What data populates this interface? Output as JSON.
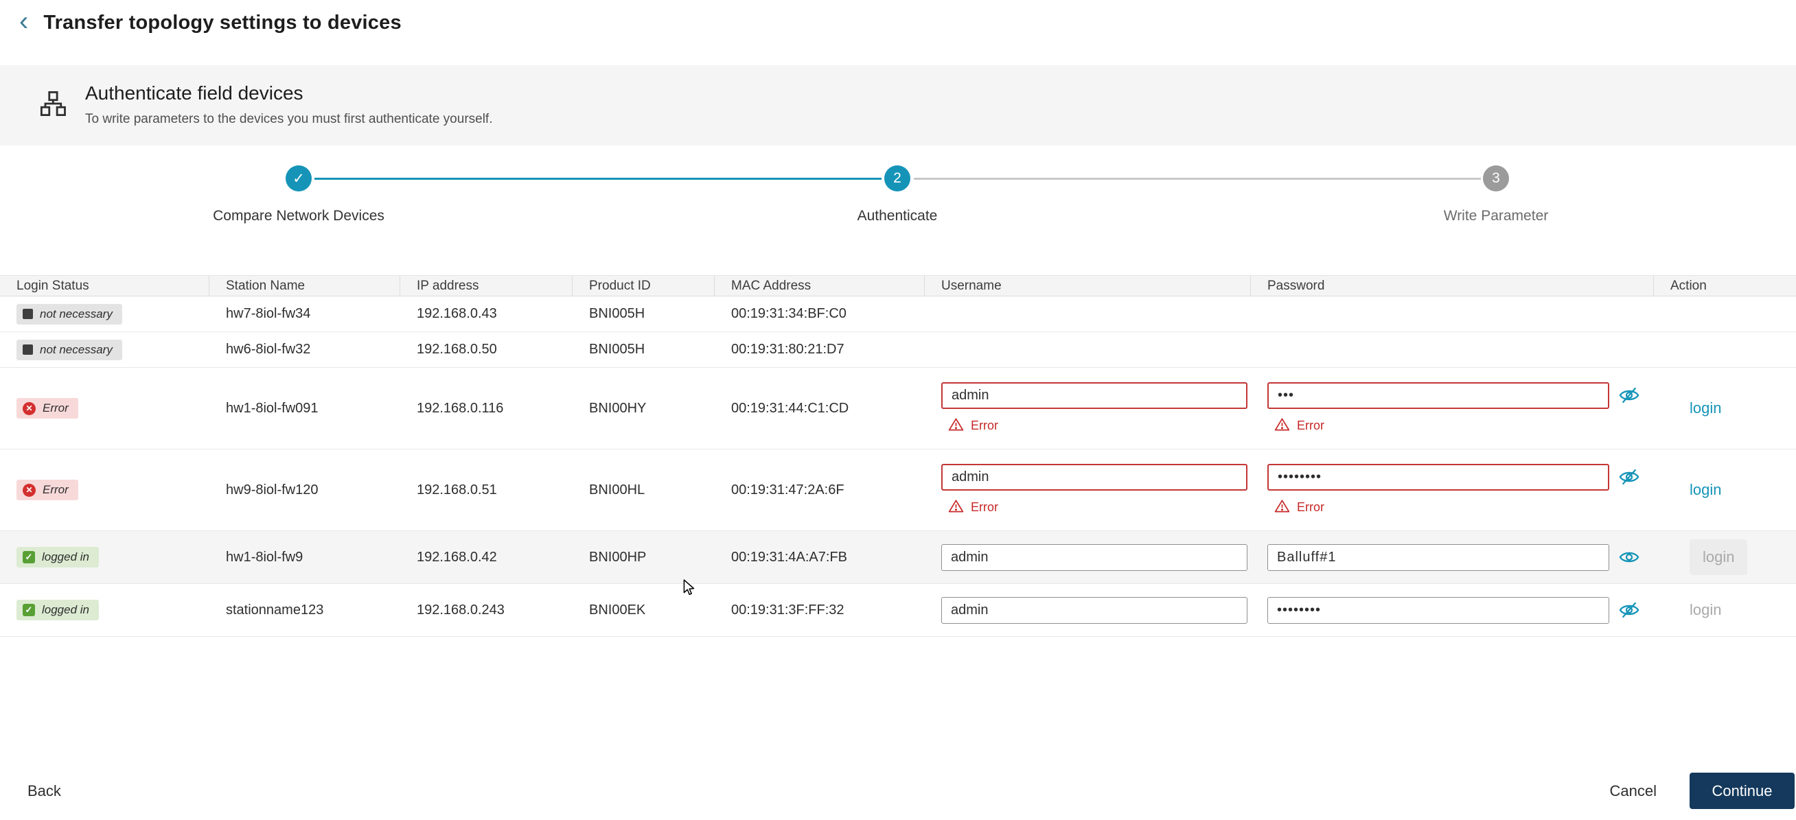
{
  "colors": {
    "accent": "#1594b8",
    "error": "#c62828",
    "continue_bg": "#14395c",
    "success": "#58a035"
  },
  "header": {
    "title": "Transfer topology settings to devices"
  },
  "banner": {
    "title": "Authenticate field devices",
    "subtitle": "To write parameters to the devices you must first authenticate yourself."
  },
  "stepper": {
    "steps": [
      {
        "symbol": "✓",
        "label": "Compare Network Devices",
        "state": "completed"
      },
      {
        "symbol": "2",
        "label": "Authenticate",
        "state": "active"
      },
      {
        "symbol": "3",
        "label": "Write Parameter",
        "state": "upcoming"
      }
    ]
  },
  "table": {
    "columns": [
      "Login Status",
      "Station Name",
      "IP address",
      "Product ID",
      "MAC Address",
      "Username",
      "Password",
      "Action"
    ],
    "rows": [
      {
        "status": "not necessary",
        "status_type": "neutral",
        "station": "hw7-8iol-fw34",
        "ip": "192.168.0.43",
        "product": "BNI005H",
        "mac": "00:19:31:34:BF:C0",
        "credentials": false
      },
      {
        "status": "not necessary",
        "status_type": "neutral",
        "station": "hw6-8iol-fw32",
        "ip": "192.168.0.50",
        "product": "BNI005H",
        "mac": "00:19:31:80:21:D7",
        "credentials": false
      },
      {
        "status": "Error",
        "status_type": "error",
        "station": "hw1-8iol-fw091",
        "ip": "192.168.0.116",
        "product": "BNI00HY",
        "mac": "00:19:31:44:C1:CD",
        "credentials": true,
        "username": "admin",
        "password": "•••",
        "username_error": "Error",
        "password_error": "Error",
        "password_visible": false,
        "action": "login",
        "action_enabled": true,
        "highlighted": false
      },
      {
        "status": "Error",
        "status_type": "error",
        "station": "hw9-8iol-fw120",
        "ip": "192.168.0.51",
        "product": "BNI00HL",
        "mac": "00:19:31:47:2A:6F",
        "credentials": true,
        "username": "admin",
        "password": "••••••••",
        "username_error": "Error",
        "password_error": "Error",
        "password_visible": false,
        "action": "login",
        "action_enabled": true,
        "highlighted": false
      },
      {
        "status": "logged in",
        "status_type": "success",
        "station": "hw1-8iol-fw9",
        "ip": "192.168.0.42",
        "product": "BNI00HP",
        "mac": "00:19:31:4A:A7:FB",
        "credentials": true,
        "username": "admin",
        "password": "Balluff#1",
        "password_visible": true,
        "action": "login",
        "action_enabled": false,
        "highlighted": true
      },
      {
        "status": "logged in",
        "status_type": "success",
        "station": "stationname123",
        "ip": "192.168.0.243",
        "product": "BNI00EK",
        "mac": "00:19:31:3F:FF:32",
        "credentials": true,
        "username": "admin",
        "password": "••••••••",
        "password_visible": false,
        "action": "login",
        "action_enabled": false,
        "highlighted": false
      }
    ]
  },
  "footer": {
    "back": "Back",
    "cancel": "Cancel",
    "continue": "Continue"
  },
  "icons": {
    "back": "chevron-left",
    "banner": "topology",
    "status_neutral": "filled-square",
    "status_error": "circle-x",
    "status_success": "check-square",
    "password_hidden": "eye-slash",
    "password_visible": "eye",
    "field_error": "warning-triangle",
    "pointer": "mouse-cursor"
  }
}
